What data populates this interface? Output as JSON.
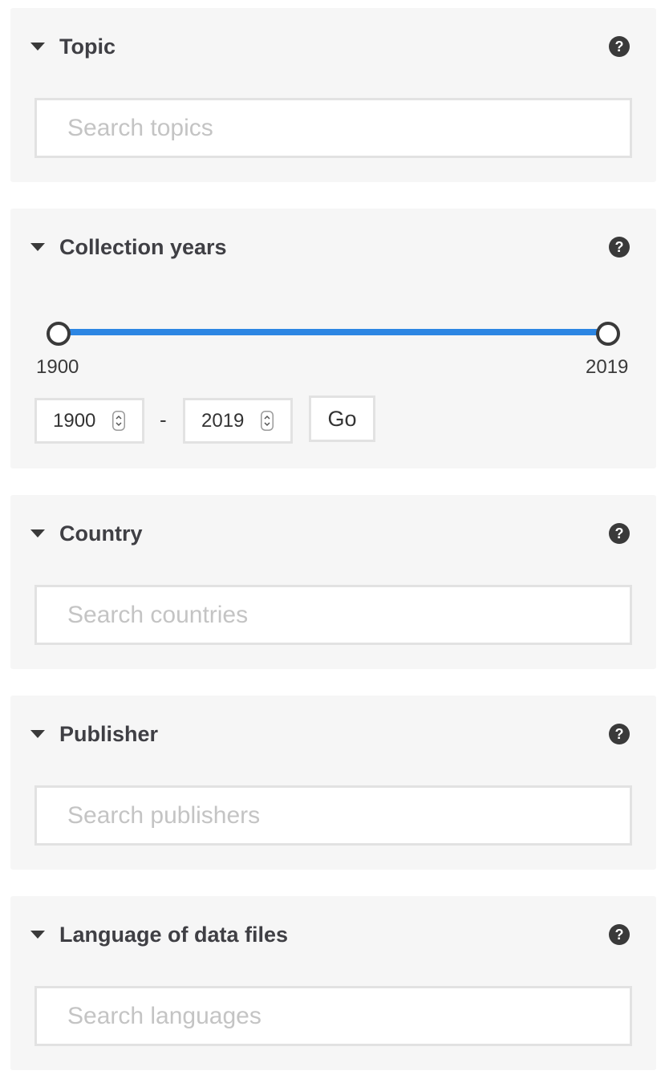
{
  "topic": {
    "title": "Topic",
    "search_placeholder": "Search topics",
    "help_icon": "question-circle-icon"
  },
  "collection_years": {
    "title": "Collection years",
    "help_icon": "question-circle-icon",
    "slider": {
      "min_label": "1900",
      "max_label": "2019",
      "range_min": 1900,
      "range_max": 2019,
      "selected_from": 1900,
      "selected_to": 2019,
      "track_color": "#2c86e3"
    },
    "from_value": "1900",
    "dash": "-",
    "to_value": "2019",
    "go_label": "Go"
  },
  "country": {
    "title": "Country",
    "search_placeholder": "Search countries",
    "help_icon": "question-circle-icon"
  },
  "publisher": {
    "title": "Publisher",
    "search_placeholder": "Search publishers",
    "help_icon": "question-circle-icon"
  },
  "language": {
    "title": "Language of data files",
    "search_placeholder": "Search languages",
    "help_icon": "question-circle-icon"
  },
  "colors": {
    "panel_bg": "#f6f6f6",
    "accent": "#2c86e3",
    "text": "#3f3f44",
    "placeholder": "#c4c4c4"
  }
}
